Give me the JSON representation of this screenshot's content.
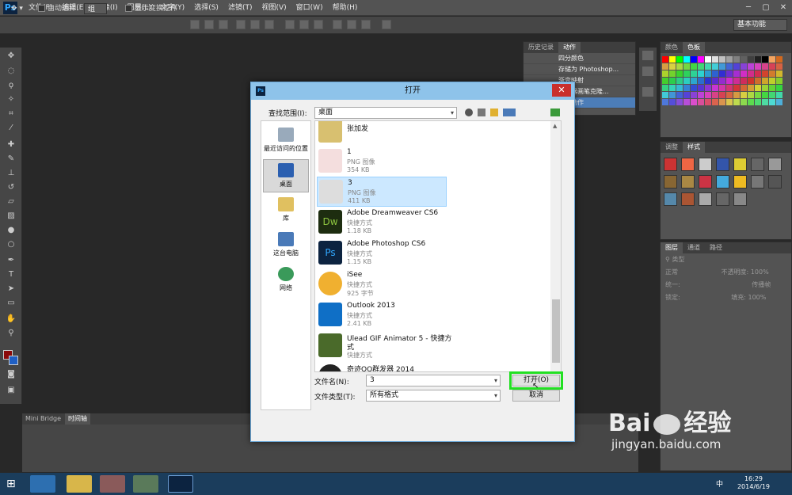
{
  "app": {
    "logo": "Ps",
    "menu": [
      "文件(F)",
      "编辑(E)",
      "图像(I)",
      "图层(L)",
      "文字(Y)",
      "选择(S)",
      "滤镜(T)",
      "视图(V)",
      "窗口(W)",
      "帮助(H)"
    ],
    "window_controls": [
      "─",
      "▢",
      "✕"
    ]
  },
  "options": {
    "auto_select_label": "自动选择:",
    "auto_select_value": "组",
    "transform_label": "显示变换控件",
    "workspace": "基本功能"
  },
  "panels": {
    "history_tab": "历史记录",
    "actions_tab": "动作",
    "actions": [
      "四分颜色",
      "存储为 Photoshop...",
      "渐变映射",
      "混合器画笔克隆...",
      "创建动作"
    ],
    "color_tab": "颜色",
    "swatches_tab": "色板",
    "adjust_tab": "调整",
    "styles_tab": "样式",
    "layers_tab": "图层",
    "channels_tab": "通道",
    "paths_tab": "路径",
    "layer_kind": "类型",
    "blend_mode": "正常",
    "opacity_label": "不透明度:",
    "opacity_value": "100%",
    "unify_label": "统一:",
    "propagate_label": "传播帧",
    "lock_label": "锁定:",
    "fill_label": "填充:",
    "fill_value": "100%"
  },
  "bottom": {
    "tab_bridge": "Mini Bridge",
    "tab_timeline": "时间轴"
  },
  "dialog": {
    "title": "打开",
    "look_in_label": "查找范围(I):",
    "look_in_value": "桌面",
    "places": [
      "最近访问的位置",
      "桌面",
      "库",
      "这台电脑",
      "网络"
    ],
    "files": [
      {
        "name": "张加发",
        "type": "",
        "size": ""
      },
      {
        "name": "1",
        "type": "PNG 图像",
        "size": "354 KB"
      },
      {
        "name": "3",
        "type": "PNG 图像",
        "size": "411 KB"
      },
      {
        "name": "Adobe Dreamweaver CS6",
        "type": "快捷方式",
        "size": "1.18 KB"
      },
      {
        "name": "Adobe Photoshop CS6",
        "type": "快捷方式",
        "size": "1.15 KB"
      },
      {
        "name": "iSee",
        "type": "快捷方式",
        "size": "925 字节"
      },
      {
        "name": "Outlook 2013",
        "type": "快捷方式",
        "size": "2.41 KB"
      },
      {
        "name": "Ulead GIF Animator 5 - 快捷方",
        "name2": "式",
        "type": "快捷方式",
        "size": ""
      },
      {
        "name": "奇迹QQ群发器 2014",
        "type": "",
        "size": ""
      }
    ],
    "filename_label": "文件名(N):",
    "filename_value": "3",
    "filetype_label": "文件类型(T):",
    "filetype_value": "所有格式",
    "open_button": "打开(O)",
    "cancel_button": "取消",
    "dw_glyph": "Dw",
    "ps_glyph": "Ps"
  },
  "taskbar": {
    "time": "16:29",
    "date": "2014/6/19",
    "ime": "中"
  },
  "watermark": {
    "brand": "Bai",
    "brand2": "经验",
    "url": "jingyan.baidu.com"
  },
  "colors": {
    "selection": "#cce8ff",
    "highlight_box": "#22e022",
    "dialog_title": "#8ec3ea"
  }
}
